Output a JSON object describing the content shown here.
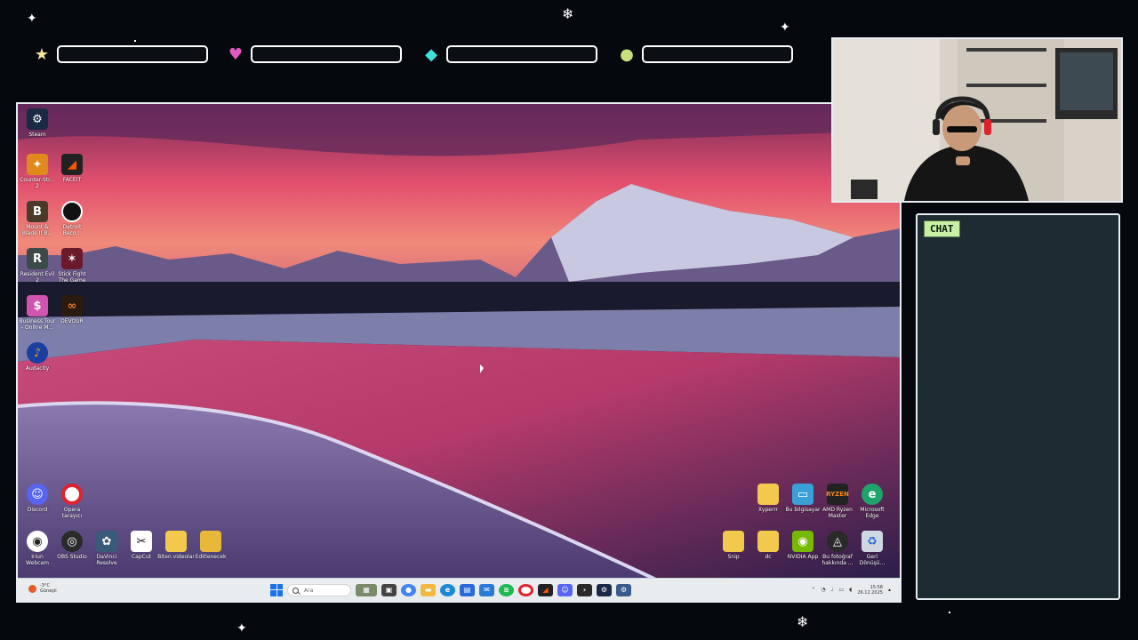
{
  "colors": {
    "background": "#05080d",
    "frame_border": "#e8edf2",
    "chat_bg": "#1d2b33",
    "chat_label_bg": "#c7f0a3",
    "taskbar_bg": "#e9ecef"
  },
  "overlay": {
    "badges": [
      {
        "icon": "yellow-star-icon",
        "color": "#f3e69a"
      },
      {
        "icon": "pink-heart-icon",
        "color": "#e05ac2"
      },
      {
        "icon": "cyan-diamond-icon",
        "color": "#3fe0e0"
      },
      {
        "icon": "green-circle-icon",
        "color": "#c8e07a"
      }
    ],
    "chat_label": "CHAT"
  },
  "desktop": {
    "left_icons": [
      {
        "label": "Steam",
        "icon": "steam-icon",
        "color": "#1b2a44"
      },
      {
        "label": "Counter-Str...\n2",
        "icon": "counter-strike-icon",
        "color": "#e08a1e"
      },
      {
        "label": "FACEIT",
        "icon": "faceit-icon",
        "color": "#222222"
      },
      {
        "label": "Mount &\nBlade II B...",
        "icon": "bannerlord-icon",
        "color": "#4a3a2a"
      },
      {
        "label": "Detroit\nBeco...",
        "icon": "detroit-icon",
        "color": "#111111"
      },
      {
        "label": "Resident Evil\n2",
        "icon": "resident-evil-icon",
        "color": "#3d4a4a"
      },
      {
        "label": "Stick Fight\nThe Game",
        "icon": "stick-fight-icon",
        "color": "#6a1a2a"
      },
      {
        "label": "Business Tour\n- Online M...",
        "icon": "business-tour-icon",
        "color": "#d054b0"
      },
      {
        "label": "DEVOUR",
        "icon": "devour-icon",
        "color": "#2a1a10"
      },
      {
        "label": "Audacity",
        "icon": "audacity-icon",
        "color": "#1a3fa0"
      },
      {
        "label": "Discord",
        "icon": "discord-icon",
        "color": "#5865f2"
      },
      {
        "label": "Opera\ntarayıcı",
        "icon": "opera-icon",
        "color": "#e0222e"
      },
      {
        "label": "Iriun\nWebcam",
        "icon": "iriun-webcam-icon",
        "color": "#222222"
      },
      {
        "label": "OBS Studio",
        "icon": "obs-icon",
        "color": "#2a2a2a"
      },
      {
        "label": "DaVinci\nResolve",
        "icon": "davinci-resolve-icon",
        "color": "#3a5a7a"
      },
      {
        "label": "CapCut",
        "icon": "capcut-icon",
        "color": "#111111"
      },
      {
        "label": "Biten videolar",
        "icon": "folder-icon",
        "color": "#f2c94c"
      },
      {
        "label": "Editlenecek",
        "icon": "folder-icon",
        "color": "#e8b83a"
      }
    ],
    "right_icons": [
      {
        "label": "Xyperrr",
        "icon": "folder-icon",
        "color": "#f2c94c"
      },
      {
        "label": "Bu bilgisayar",
        "icon": "computer-icon",
        "color": "#3aa0d8"
      },
      {
        "label": "AMD Ryzen\nMaster",
        "icon": "amd-ryzen-icon",
        "color": "#222222"
      },
      {
        "label": "Microsoft\nEdge",
        "icon": "edge-icon",
        "color": "#1ea46a"
      },
      {
        "label": "Snip",
        "icon": "folder-icon",
        "color": "#f2c94c"
      },
      {
        "label": "dc",
        "icon": "folder-icon",
        "color": "#f2c94c"
      },
      {
        "label": "NVIDIA App",
        "icon": "nvidia-icon",
        "color": "#76b900"
      },
      {
        "label": "Bu fotoğraf\nhakkında ...",
        "icon": "camera-info-icon",
        "color": "#2a2a2a"
      },
      {
        "label": "Geri\nDönüşü...",
        "icon": "recycle-bin-icon",
        "color": "#cfd8e0"
      }
    ]
  },
  "taskbar": {
    "weather_temp": "-3°C",
    "weather_desc": "Güneşli",
    "search_placeholder": "Ara",
    "apps": [
      {
        "icon": "widgets-icon",
        "color": "#7a8a6a"
      },
      {
        "icon": "task-view-icon",
        "color": "#444444"
      },
      {
        "icon": "chrome-icon",
        "color": "#4285f4"
      },
      {
        "icon": "file-explorer-icon",
        "color": "#f2b840"
      },
      {
        "icon": "edge-icon",
        "color": "#1a8ad8"
      },
      {
        "icon": "store-icon",
        "color": "#2a6ad8"
      },
      {
        "icon": "mail-icon",
        "color": "#2a7ad8"
      },
      {
        "icon": "spotify-icon",
        "color": "#1db954"
      },
      {
        "icon": "opera-icon",
        "color": "#e0222e"
      },
      {
        "icon": "premiere-icon",
        "color": "#222222"
      },
      {
        "icon": "discord-icon",
        "color": "#5865f2"
      },
      {
        "icon": "terminal-icon",
        "color": "#2a2a2a"
      },
      {
        "icon": "steam-icon",
        "color": "#1b2a44"
      },
      {
        "icon": "steam-alt-icon",
        "color": "#3a5a8a"
      }
    ],
    "time": "15:58",
    "date": "26.12.2025"
  }
}
